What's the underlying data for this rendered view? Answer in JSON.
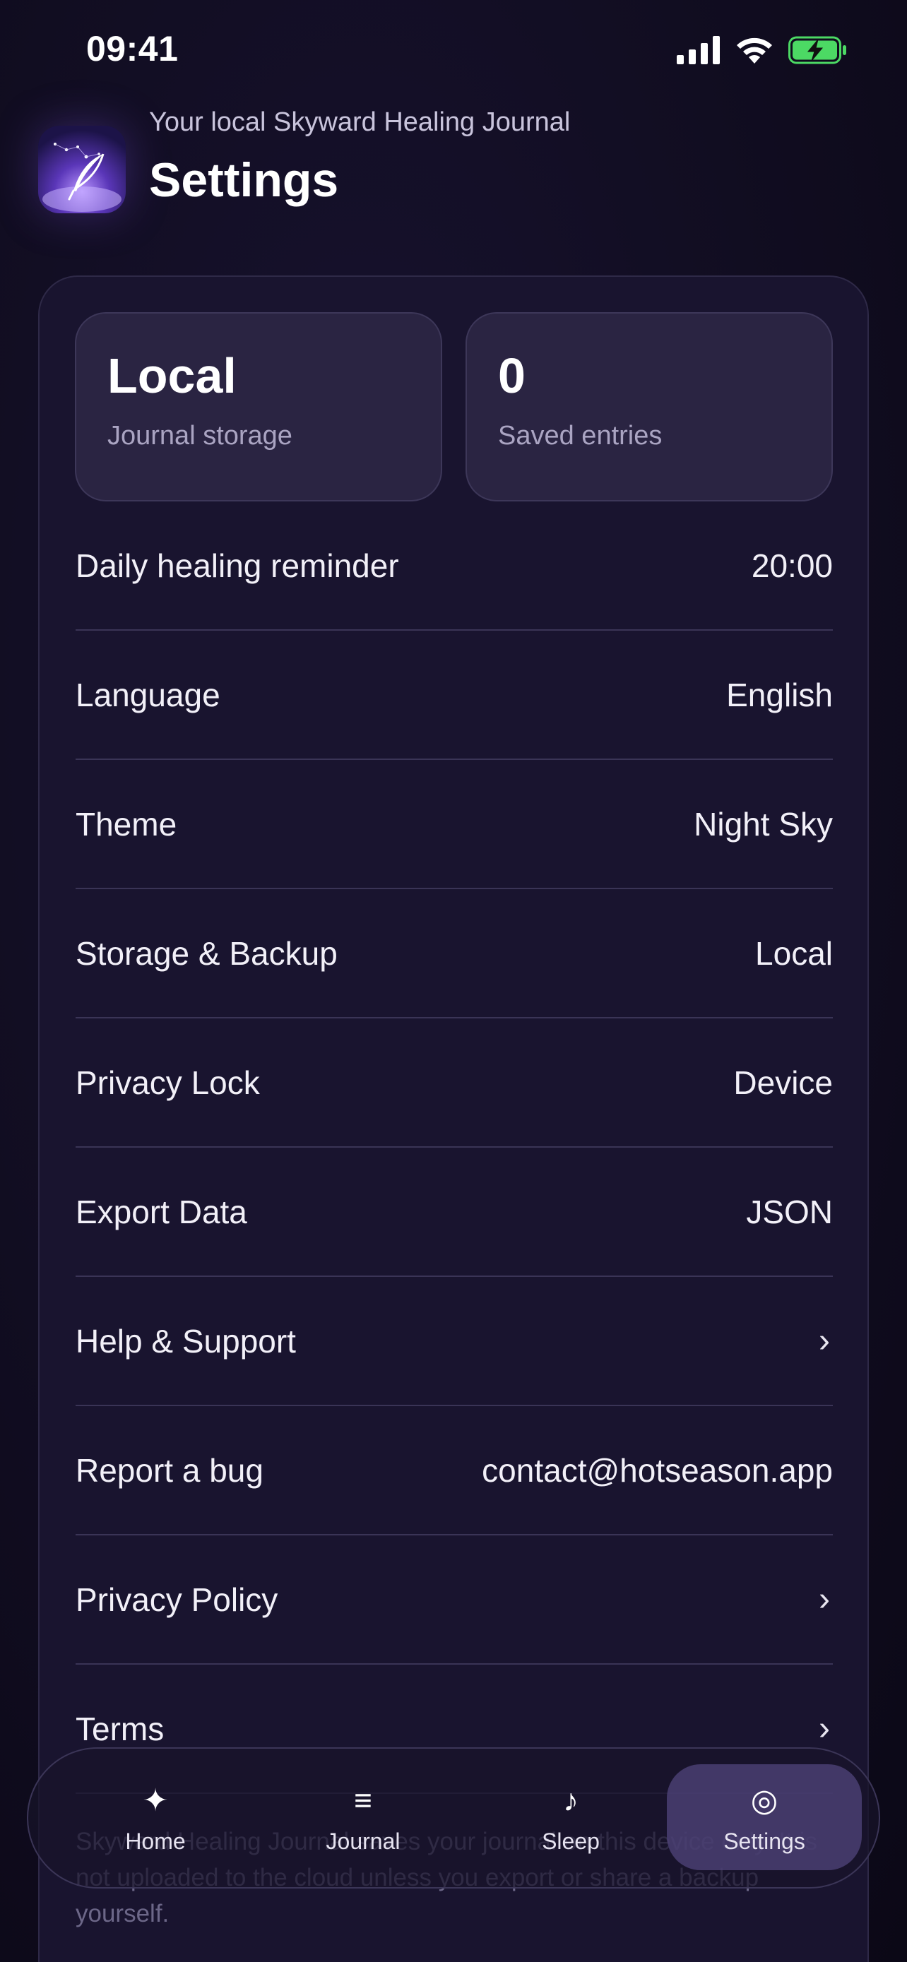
{
  "status_bar": {
    "time": "09:41",
    "icons": [
      "cellular-signal-icon",
      "wifi-icon",
      "battery-charging-icon"
    ]
  },
  "header": {
    "subtitle": "Your local Skyward Healing Journal",
    "title": "Settings",
    "app_icon": "journal-feather-icon"
  },
  "stats": [
    {
      "value": "Local",
      "label": "Journal storage"
    },
    {
      "value": "0",
      "label": "Saved entries"
    }
  ],
  "settings": [
    {
      "label": "Daily healing reminder",
      "value": "20:00"
    },
    {
      "label": "Language",
      "value": "English"
    },
    {
      "label": "Theme",
      "value": "Night Sky"
    },
    {
      "label": "Storage & Backup",
      "value": "Local"
    },
    {
      "label": "Privacy Lock",
      "value": "Device"
    },
    {
      "label": "Export Data",
      "value": "JSON"
    },
    {
      "label": "Help & Support",
      "value": "›"
    },
    {
      "label": "Report a bug",
      "value": "contact@hotseason.app"
    },
    {
      "label": "Privacy Policy",
      "value": "›"
    },
    {
      "label": "Terms",
      "value": "›"
    }
  ],
  "footer_note": "Skyward Healing Journal saves your journal on this device only. It is not uploaded to the cloud unless you export or share a backup yourself.",
  "tabbar": {
    "items": [
      {
        "label": "Home",
        "icon": "✦",
        "icon_name": "sparkle-icon"
      },
      {
        "label": "Journal",
        "icon": "≡",
        "icon_name": "list-icon"
      },
      {
        "label": "Sleep",
        "icon": "♪",
        "icon_name": "music-note-icon"
      },
      {
        "label": "Settings",
        "icon": "◎",
        "icon_name": "settings-ring-icon"
      }
    ],
    "active": "Settings"
  },
  "colors": {
    "background": "#100c1e",
    "card": "#19142f",
    "stat_tile": "#2a2442",
    "divider": "#3a3456",
    "battery_charging": "#4cd964",
    "active_tab": "#4e4278"
  }
}
